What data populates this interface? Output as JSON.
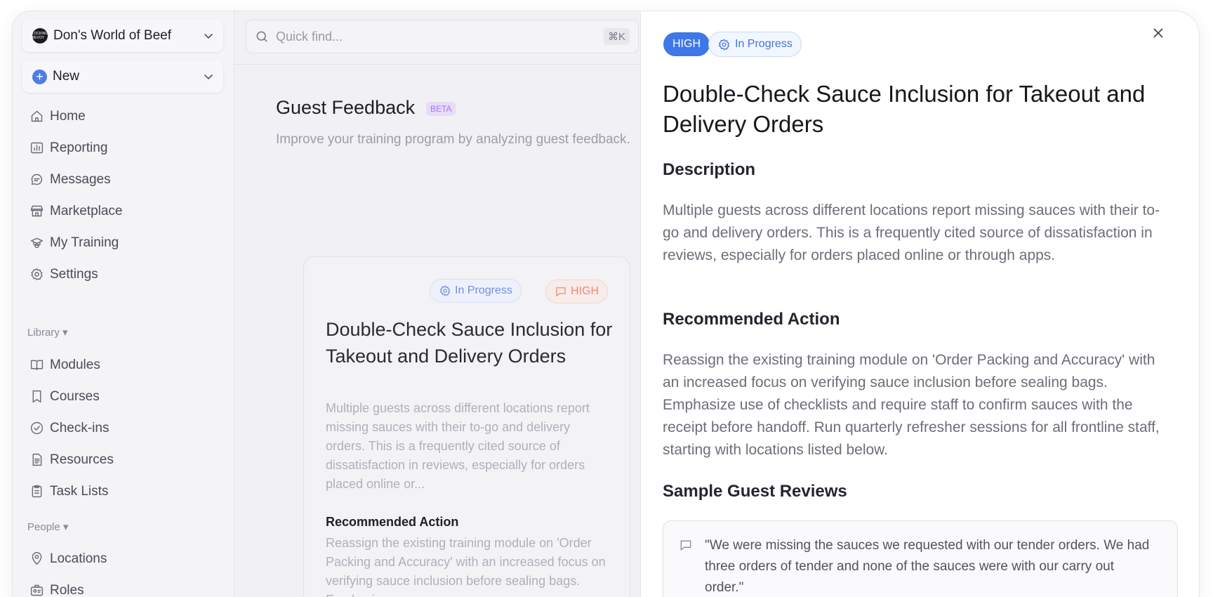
{
  "org": {
    "name": "Don's World of Beef",
    "logo_text": "LOCKING BEVOY"
  },
  "new_menu": {
    "label": "New"
  },
  "nav": [
    {
      "label": "Home",
      "icon": "home-icon"
    },
    {
      "label": "Reporting",
      "icon": "chart-icon"
    },
    {
      "label": "Messages",
      "icon": "message-icon"
    },
    {
      "label": "Marketplace",
      "icon": "store-icon"
    },
    {
      "label": "My Training",
      "icon": "graduation-icon"
    },
    {
      "label": "Settings",
      "icon": "gear-icon"
    }
  ],
  "library": {
    "label": "Library ▾",
    "items": [
      {
        "label": "Modules",
        "icon": "book-icon"
      },
      {
        "label": "Courses",
        "icon": "bookmark-icon"
      },
      {
        "label": "Check-ins",
        "icon": "check-circle-icon"
      },
      {
        "label": "Resources",
        "icon": "document-icon"
      },
      {
        "label": "Task Lists",
        "icon": "clipboard-icon"
      }
    ]
  },
  "people": {
    "label": "People ▾",
    "items": [
      {
        "label": "Locations",
        "icon": "pin-icon"
      },
      {
        "label": "Roles",
        "icon": "badge-icon"
      }
    ]
  },
  "search": {
    "placeholder": "Quick find...",
    "shortcut": "⌘K"
  },
  "page": {
    "title": "Guest Feedback",
    "beta": "BETA",
    "subtitle": "Improve your training program by analyzing guest feedback."
  },
  "card": {
    "status": "In Progress",
    "priority": "HIGH",
    "title": "Double-Check Sauce Inclusion for Takeout and Delivery Orders",
    "description": "Multiple guests across different locations report missing sauces with their to-go and delivery orders. This is a frequently cited source of dissatisfaction in reviews, especially for orders placed online or...",
    "rec_heading": "Recommended Action",
    "rec_text": "Reassign the existing training module on 'Order Packing and Accuracy' with an increased focus on verifying sauce inclusion before sealing bags. Emphasize"
  },
  "panel": {
    "priority": "HIGH",
    "status": "In Progress",
    "title": "Double-Check Sauce Inclusion for Takeout and Delivery Orders",
    "desc_heading": "Description",
    "description": "Multiple guests across different locations report missing sauces with their to-go and delivery orders. This is a frequently cited source of dissatisfaction in reviews, especially for orders placed online or through apps.",
    "rec_heading": "Recommended Action",
    "recommendation": "Reassign the existing training module on 'Order Packing and Accuracy' with an increased focus on verifying sauce inclusion before sealing bags. Emphasize use of checklists and require staff to confirm sauces with the receipt before handoff. Run quarterly refresher sessions for all frontline staff, starting with locations listed below.",
    "reviews_heading": "Sample Guest Reviews",
    "reviews": [
      "\"We were missing the sauces we requested with our tender orders. We had three orders of tender and none of the sauces were with our carry out order.\""
    ]
  },
  "colors": {
    "accent": "#3e78e8",
    "priority_soft": "#f08a72",
    "beta_bg": "#e8dbfa"
  }
}
